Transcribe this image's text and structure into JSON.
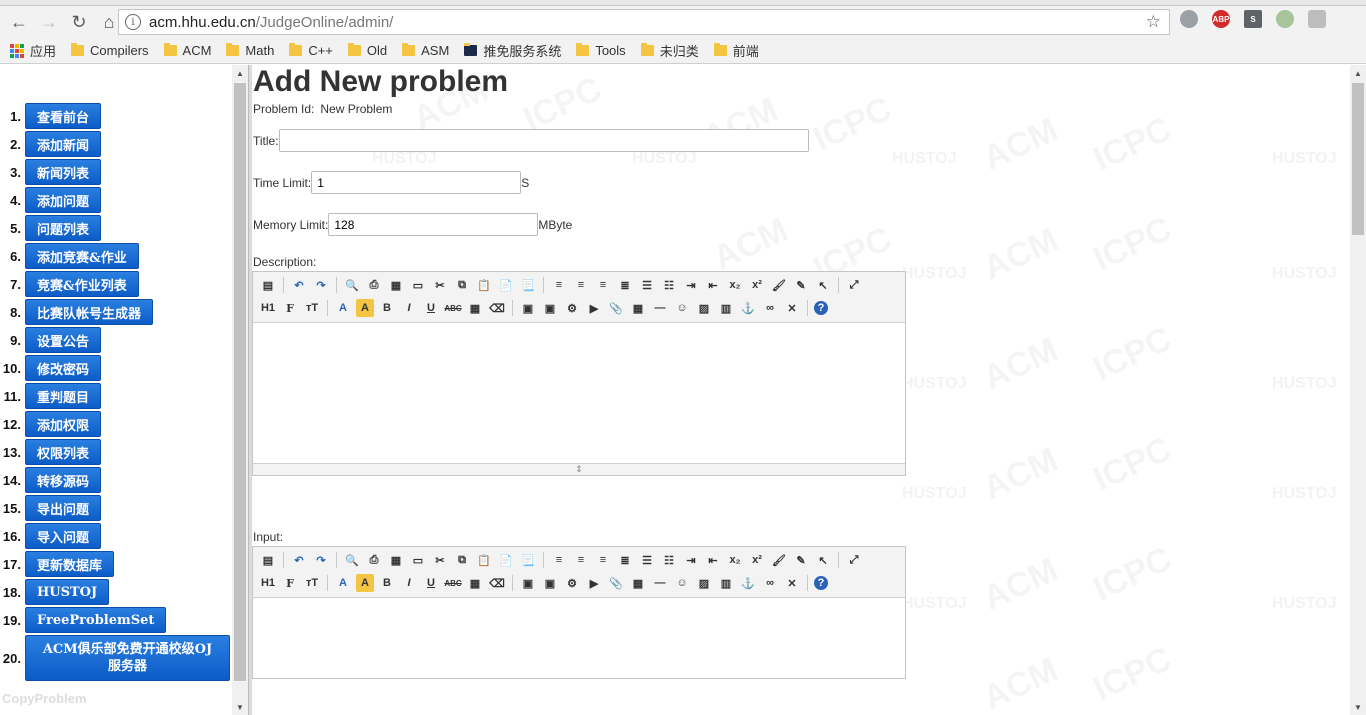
{
  "browser": {
    "url_host": "acm.hhu.edu.cn",
    "url_path": "/JudgeOnline/admin/",
    "bookmarks": [
      "应用",
      "Compilers",
      "ACM",
      "Math",
      "C++",
      "Old",
      "ASM",
      "推免服务系统",
      "Tools",
      "未归类",
      "前端"
    ],
    "extensions": [
      "translate-icon",
      "adblock-icon",
      "s-icon",
      "green-dot-icon",
      "puzzle-icon"
    ],
    "ext_labels": {
      "abp": "ABP",
      "s": "S"
    }
  },
  "sidebar": {
    "items": [
      {
        "num": "1.",
        "label": "查看前台"
      },
      {
        "num": "2.",
        "label": "添加新闻"
      },
      {
        "num": "3.",
        "label": "新闻列表"
      },
      {
        "num": "4.",
        "label": "添加问题"
      },
      {
        "num": "5.",
        "label": "问题列表"
      },
      {
        "num": "6.",
        "label": "添加竞赛&作业"
      },
      {
        "num": "7.",
        "label": "竞赛&作业列表"
      },
      {
        "num": "8.",
        "label": "比赛队帐号生成器"
      },
      {
        "num": "9.",
        "label": "设置公告"
      },
      {
        "num": "10.",
        "label": "修改密码"
      },
      {
        "num": "11.",
        "label": "重判题目"
      },
      {
        "num": "12.",
        "label": "添加权限"
      },
      {
        "num": "13.",
        "label": "权限列表"
      },
      {
        "num": "14.",
        "label": "转移源码"
      },
      {
        "num": "15.",
        "label": "导出问题"
      },
      {
        "num": "16.",
        "label": "导入问题"
      },
      {
        "num": "17.",
        "label": "更新数据库"
      },
      {
        "num": "18.",
        "label": "HUSTOJ"
      },
      {
        "num": "19.",
        "label": "FreeProblemSet"
      },
      {
        "num": "20.",
        "label": "ACM俱乐部免费开通校级OJ服务器"
      }
    ],
    "footer": "CopyProblem"
  },
  "form": {
    "heading": "Add New problem",
    "problem_id_label": "Problem Id:",
    "problem_id_value": "New Problem",
    "title_label": "Title:",
    "title_value": "",
    "time_limit_label": "Time Limit:",
    "time_limit_value": "1",
    "time_limit_unit": "S",
    "memory_limit_label": "Memory Limit:",
    "memory_limit_value": "128",
    "memory_limit_unit": "MByte",
    "description_label": "Description:",
    "input_label": "Input:"
  },
  "editor_toolbar": {
    "heading_btn": "H1",
    "font_btn": "F",
    "size_btn": "тT",
    "font_color_btn": "A",
    "highlight_btn": "A",
    "bold": "B",
    "italic": "I",
    "underline": "U",
    "strike": "ABC",
    "sub": "x₂",
    "sup": "x²",
    "help": "?",
    "grip": "⇕"
  },
  "watermark": {
    "a": "ACM",
    "b": "ICPC",
    "c": "HUSTOJ"
  }
}
